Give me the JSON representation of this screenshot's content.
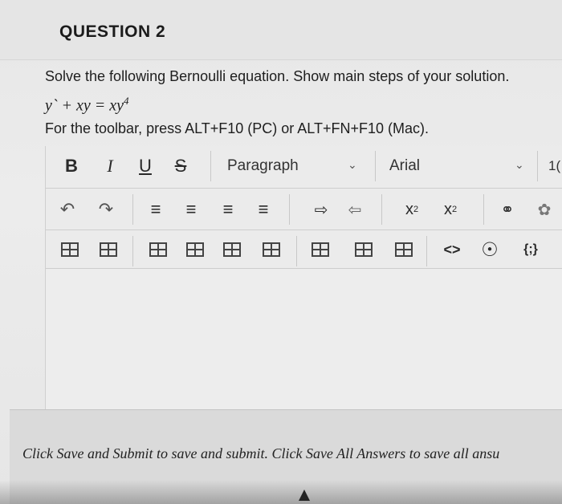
{
  "question": {
    "title": "QUESTION 2"
  },
  "prompt": {
    "instruction": "Solve the following Bernoulli equation. Show main steps of your solution.",
    "equation_main": "y` + xy = xy",
    "equation_exponent": "4",
    "toolbar_hint": "For the toolbar, press ALT+F10 (PC) or ALT+FN+F10 (Mac)."
  },
  "toolbar": {
    "bold": "B",
    "italic": "I",
    "underline": "U",
    "strikethrough": "S",
    "paragraph_select": "Paragraph",
    "font_select": "Arial",
    "font_size_partial": "1("
  },
  "footer": {
    "text": "Click Save and Submit to save and submit. Click Save All Answers to save all ansu"
  },
  "icons": [
    "undo-icon",
    "redo-icon",
    "align-left-icon",
    "align-center-icon",
    "align-right-icon",
    "align-justify-icon",
    "indent-icon",
    "outdent-icon",
    "superscript-icon",
    "subscript-icon",
    "link-icon",
    "unlink-icon",
    "table-icon",
    "code-icon",
    "accessibility-icon",
    "source-code-icon"
  ]
}
